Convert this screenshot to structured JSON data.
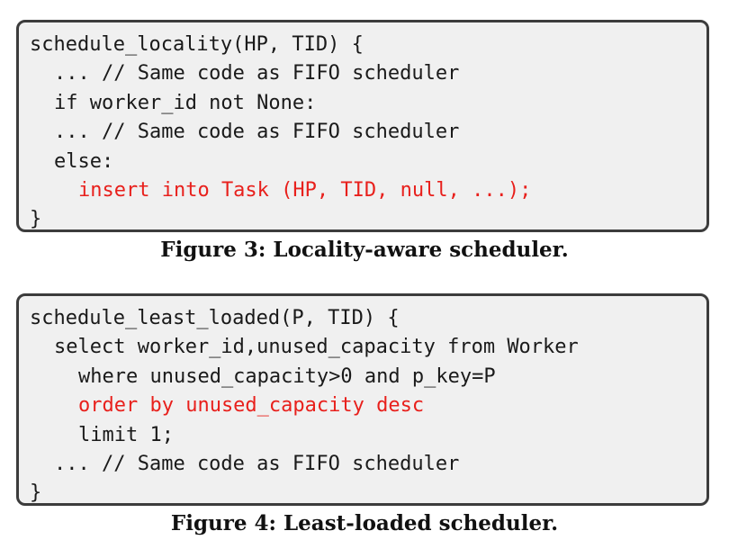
{
  "figures": [
    {
      "caption": "Figure 3: Locality-aware scheduler.",
      "code": [
        "schedule_locality(HP, TID) {",
        "... // Same code as FIFO scheduler",
        "if worker_id not None:",
        "... // Same code as FIFO scheduler",
        "else:",
        "insert into Task (HP, TID, null, ...);",
        "}"
      ]
    },
    {
      "caption": "Figure 4: Least-loaded scheduler.",
      "code": [
        "schedule_least_loaded(P, TID) {",
        "select worker_id,unused_capacity from Worker",
        "where unused_capacity>0 and p_key=P",
        "order by unused_capacity desc",
        "limit 1;",
        "... // Same code as FIFO scheduler",
        "}"
      ]
    }
  ],
  "colors": {
    "highlight": "#e8201c",
    "code_text": "#1a1a1a",
    "box_background": "#f0f0f0",
    "box_border": "#3c3c3c"
  }
}
